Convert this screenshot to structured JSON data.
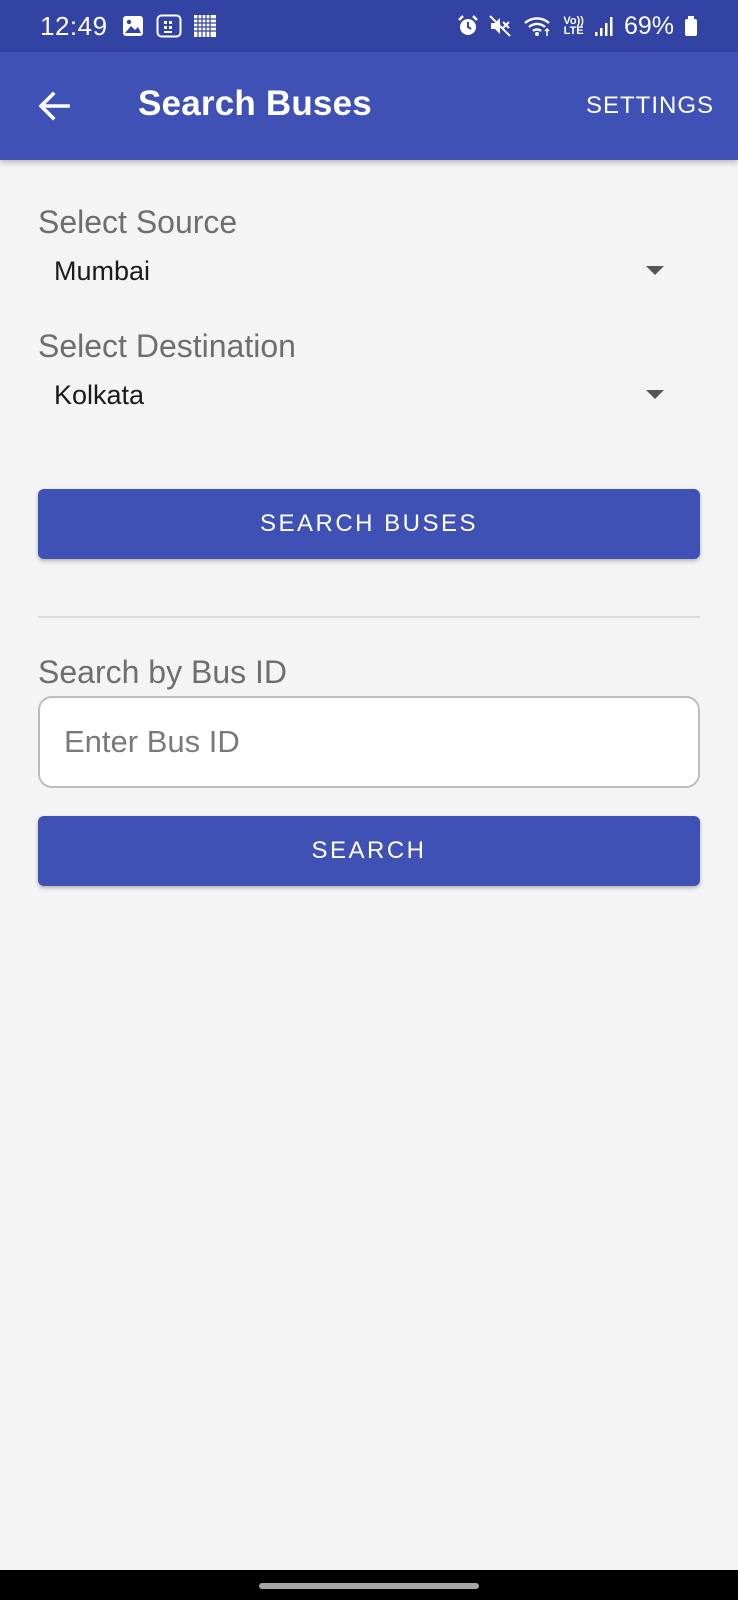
{
  "status_bar": {
    "time": "12:49",
    "battery_percent": "69%",
    "icons_left": [
      "gallery-icon",
      "sim-app-icon",
      "grid-app-icon"
    ],
    "icons_right": [
      "alarm-icon",
      "mute-icon",
      "wifi-icon",
      "volte-icon",
      "signal-icon",
      "battery-icon"
    ],
    "volte_label_top": "Vo))",
    "volte_label_bottom": "LTE"
  },
  "app_bar": {
    "title": "Search Buses",
    "settings_label": "SETTINGS",
    "background_color": "#3f51b5"
  },
  "route_search": {
    "source_label": "Select Source",
    "source_value": "Mumbai",
    "destination_label": "Select Destination",
    "destination_value": "Kolkata",
    "search_button_label": "SEARCH BUSES"
  },
  "id_search": {
    "label": "Search by Bus ID",
    "input_value": "",
    "input_placeholder": "Enter Bus ID",
    "search_button_label": "SEARCH"
  },
  "colors": {
    "primary": "#3f51b5",
    "status_bar": "#3343a4",
    "background": "#f4f4f4"
  }
}
